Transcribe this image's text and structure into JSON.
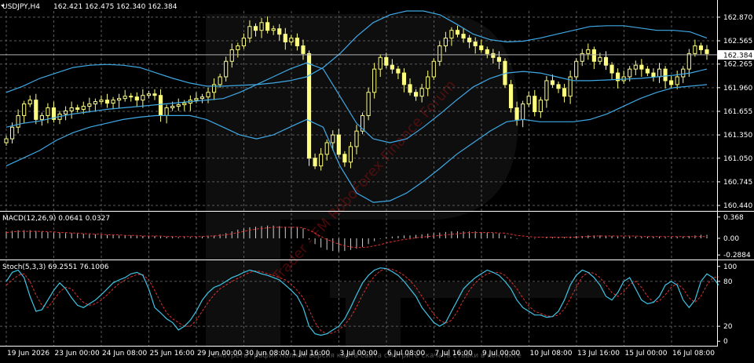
{
  "chart_data": [
    {
      "type": "candlestick",
      "panel": "price",
      "title": "USDJPY,H4",
      "ohlc_header": "162.421 162.475 162.340 162.384",
      "current_price": 162.384,
      "current_price_label": "162.384",
      "y_ticks": [
        {
          "v": 162.87,
          "label": "162.870"
        },
        {
          "v": 162.565,
          "label": "162.565"
        },
        {
          "v": 162.265,
          "label": "162.265"
        },
        {
          "v": 161.96,
          "label": "161.960"
        },
        {
          "v": 161.655,
          "label": "161.655"
        },
        {
          "v": 161.35,
          "label": "161.350"
        },
        {
          "v": 161.05,
          "label": "161.050"
        },
        {
          "v": 160.745,
          "label": "160.745"
        },
        {
          "v": 160.44,
          "label": "160.440"
        }
      ],
      "ylim": [
        160.4,
        162.95
      ],
      "x_labels": [
        "19 Jun 2026",
        "23 Jun 00:00",
        "24 Jun 08:00",
        "25 Jun 16:00",
        "29 Jun 00:00",
        "30 Jun 08:00",
        "1 Jul 16:00",
        "3 Jul 00:00",
        "6 Jul 08:00",
        "7 Jul 16:00",
        "9 Jul 00:00",
        "10 Jul 08:00",
        "13 Jul 16:00",
        "15 Jul 00:00",
        "16 Jul 08:00"
      ],
      "grid": true,
      "candle_color": "#ffff80",
      "band_color": "#3fa9e6",
      "closes": [
        161.3,
        161.45,
        161.6,
        161.75,
        161.8,
        161.55,
        161.6,
        161.7,
        161.55,
        161.62,
        161.66,
        161.7,
        161.68,
        161.72,
        161.75,
        161.78,
        161.8,
        161.76,
        161.8,
        161.82,
        161.85,
        161.84,
        161.8,
        161.86,
        161.88,
        161.86,
        161.6,
        161.7,
        161.72,
        161.74,
        161.76,
        161.8,
        161.82,
        161.84,
        161.9,
        162.0,
        162.1,
        162.3,
        162.45,
        162.5,
        162.6,
        162.75,
        162.7,
        162.8,
        162.7,
        162.72,
        162.65,
        162.55,
        162.6,
        162.5,
        162.4,
        161.05,
        160.95,
        161.1,
        161.25,
        161.35,
        161.1,
        161.0,
        161.2,
        161.4,
        161.6,
        161.9,
        162.2,
        162.35,
        162.25,
        162.2,
        162.15,
        162.0,
        161.9,
        161.85,
        161.95,
        162.1,
        162.3,
        162.5,
        162.6,
        162.7,
        162.65,
        162.6,
        162.55,
        162.5,
        162.45,
        162.4,
        162.35,
        162.3,
        162.0,
        161.7,
        161.55,
        161.75,
        161.85,
        161.65,
        161.8,
        162.05,
        162.0,
        161.95,
        161.85,
        162.1,
        162.3,
        162.4,
        162.45,
        162.3,
        162.35,
        162.25,
        162.15,
        162.05,
        162.1,
        162.2,
        162.25,
        162.2,
        162.15,
        162.1,
        162.2,
        162.05,
        162.0,
        162.1,
        162.2,
        162.4,
        162.5,
        162.45,
        162.4
      ],
      "bands": {
        "upper": [
          161.9,
          161.98,
          162.08,
          162.15,
          162.22,
          162.25,
          162.26,
          162.25,
          162.22,
          162.15,
          162.08,
          162.02,
          161.98,
          161.98,
          161.99,
          162.0,
          162.02,
          162.05,
          162.1,
          162.22,
          162.4,
          162.62,
          162.8,
          162.9,
          162.95,
          162.95,
          162.9,
          162.78,
          162.65,
          162.58,
          162.55,
          162.56,
          162.6,
          162.65,
          162.7,
          162.75,
          162.76,
          162.76,
          162.73,
          162.7,
          162.7,
          162.68,
          162.6
        ],
        "middle": [
          161.45,
          161.5,
          161.53,
          161.58,
          161.62,
          161.65,
          161.68,
          161.7,
          161.72,
          161.74,
          161.76,
          161.78,
          161.8,
          161.82,
          161.9,
          162.0,
          162.1,
          162.2,
          162.28,
          162.2,
          161.85,
          161.5,
          161.3,
          161.25,
          161.3,
          161.45,
          161.62,
          161.8,
          161.97,
          162.08,
          162.15,
          162.17,
          162.15,
          162.1,
          162.05,
          162.05,
          162.06,
          162.07,
          162.08,
          162.1,
          162.12,
          162.15,
          162.2
        ],
        "lower": [
          160.95,
          161.05,
          161.15,
          161.28,
          161.38,
          161.45,
          161.5,
          161.55,
          161.58,
          161.6,
          161.6,
          161.6,
          161.55,
          161.45,
          161.35,
          161.3,
          161.35,
          161.45,
          161.55,
          161.45,
          160.95,
          160.6,
          160.48,
          160.5,
          160.6,
          160.75,
          160.92,
          161.1,
          161.25,
          161.4,
          161.52,
          161.55,
          161.52,
          161.52,
          161.52,
          161.55,
          161.62,
          161.72,
          161.82,
          161.9,
          161.96,
          161.98,
          162.0
        ]
      }
    },
    {
      "type": "histogram",
      "panel": "macd",
      "title": "MACD(12,26,9) 0.0641 0.0327",
      "y_ticks": [
        {
          "v": 0.368,
          "label": "0.368"
        },
        {
          "v": 0.0,
          "label": "0.00"
        },
        {
          "v": -0.2884,
          "label": "-0.2884"
        }
      ],
      "ylim": [
        -0.34,
        0.42
      ],
      "histogram_color": "#d0d0d0",
      "signal_color": "#e03030",
      "histogram": [
        0.12,
        0.13,
        0.14,
        0.14,
        0.14,
        0.13,
        0.12,
        0.11,
        0.1,
        0.1,
        0.09,
        0.09,
        0.08,
        0.08,
        0.07,
        0.07,
        0.06,
        0.06,
        0.06,
        0.05,
        0.05,
        0.05,
        0.04,
        0.04,
        0.04,
        0.04,
        0.03,
        0.03,
        0.03,
        0.02,
        0.02,
        0.02,
        0.03,
        0.03,
        0.04,
        0.05,
        0.07,
        0.09,
        0.12,
        0.15,
        0.17,
        0.19,
        0.2,
        0.21,
        0.22,
        0.22,
        0.21,
        0.2,
        0.2,
        0.19,
        0.17,
        -0.02,
        -0.1,
        -0.16,
        -0.2,
        -0.22,
        -0.23,
        -0.22,
        -0.2,
        -0.18,
        -0.15,
        -0.1,
        -0.05,
        -0.01,
        0.02,
        0.03,
        0.04,
        0.05,
        0.05,
        0.06,
        0.07,
        0.08,
        0.09,
        0.1,
        0.11,
        0.12,
        0.12,
        0.12,
        0.12,
        0.12,
        0.11,
        0.1,
        0.09,
        0.08,
        0.05,
        0.02,
        -0.01,
        0.0,
        0.01,
        -0.01,
        0.0,
        0.02,
        0.02,
        0.02,
        0.02,
        0.03,
        0.04,
        0.04,
        0.05,
        0.05,
        0.05,
        0.04,
        0.04,
        0.03,
        0.03,
        0.03,
        0.03,
        0.03,
        0.03,
        0.03,
        0.03,
        0.02,
        0.02,
        0.03,
        0.03,
        0.04,
        0.05,
        0.06,
        0.06
      ],
      "signal": [
        0.1,
        0.11,
        0.12,
        0.12,
        0.12,
        0.12,
        0.12,
        0.11,
        0.11,
        0.1,
        0.1,
        0.09,
        0.09,
        0.08,
        0.08,
        0.07,
        0.07,
        0.06,
        0.06,
        0.06,
        0.05,
        0.05,
        0.05,
        0.04,
        0.04,
        0.04,
        0.04,
        0.03,
        0.03,
        0.03,
        0.03,
        0.03,
        0.03,
        0.03,
        0.04,
        0.04,
        0.05,
        0.06,
        0.08,
        0.1,
        0.12,
        0.14,
        0.16,
        0.17,
        0.18,
        0.19,
        0.19,
        0.19,
        0.19,
        0.19,
        0.18,
        0.14,
        0.09,
        0.03,
        -0.02,
        -0.06,
        -0.1,
        -0.13,
        -0.15,
        -0.16,
        -0.16,
        -0.15,
        -0.13,
        -0.11,
        -0.08,
        -0.06,
        -0.04,
        -0.02,
        -0.01,
        0.01,
        0.02,
        0.03,
        0.04,
        0.05,
        0.06,
        0.07,
        0.08,
        0.09,
        0.1,
        0.1,
        0.1,
        0.1,
        0.1,
        0.09,
        0.09,
        0.07,
        0.05,
        0.04,
        0.03,
        0.02,
        0.02,
        0.02,
        0.02,
        0.02,
        0.02,
        0.02,
        0.02,
        0.03,
        0.03,
        0.04,
        0.04,
        0.04,
        0.04,
        0.04,
        0.04,
        0.04,
        0.04,
        0.03,
        0.03,
        0.03,
        0.03,
        0.03,
        0.03,
        0.03,
        0.03,
        0.03,
        0.03,
        0.03,
        0.03
      ]
    },
    {
      "type": "line",
      "panel": "stochastic",
      "title": "Stoch(5,3,3) 69.2551 76.1006",
      "y_ticks": [
        {
          "v": 100,
          "label": "100"
        },
        {
          "v": 80,
          "label": "80"
        },
        {
          "v": 20,
          "label": "20"
        },
        {
          "v": 0,
          "label": "0"
        }
      ],
      "ylim": [
        -5,
        105
      ],
      "k_color": "#3fc6e6",
      "d_color": "#e03030",
      "k": [
        80,
        92,
        95,
        85,
        60,
        40,
        42,
        55,
        68,
        78,
        70,
        58,
        48,
        45,
        50,
        55,
        62,
        70,
        78,
        82,
        85,
        90,
        92,
        88,
        70,
        45,
        38,
        30,
        25,
        15,
        20,
        28,
        40,
        55,
        65,
        72,
        75,
        80,
        85,
        88,
        92,
        95,
        93,
        90,
        88,
        85,
        82,
        75,
        68,
        60,
        45,
        20,
        10,
        8,
        10,
        15,
        20,
        30,
        45,
        62,
        78,
        88,
        95,
        98,
        97,
        93,
        88,
        80,
        70,
        60,
        45,
        35,
        25,
        20,
        25,
        40,
        55,
        70,
        78,
        85,
        90,
        95,
        92,
        88,
        80,
        70,
        55,
        45,
        40,
        35,
        35,
        32,
        33,
        40,
        55,
        75,
        88,
        95,
        92,
        85,
        75,
        60,
        55,
        65,
        80,
        85,
        70,
        55,
        50,
        52,
        60,
        75,
        80,
        75,
        55,
        45,
        55,
        80,
        90,
        85,
        75
      ],
      "d": [
        75,
        82,
        88,
        90,
        80,
        62,
        48,
        45,
        55,
        66,
        72,
        70,
        60,
        52,
        48,
        50,
        55,
        62,
        70,
        77,
        82,
        86,
        89,
        89,
        82,
        68,
        52,
        38,
        30,
        25,
        20,
        20,
        28,
        40,
        52,
        62,
        70,
        75,
        80,
        84,
        88,
        92,
        94,
        93,
        90,
        88,
        85,
        82,
        76,
        68,
        58,
        42,
        25,
        14,
        10,
        11,
        15,
        22,
        32,
        46,
        62,
        76,
        87,
        94,
        97,
        96,
        93,
        88,
        81,
        72,
        60,
        48,
        36,
        28,
        24,
        28,
        40,
        55,
        68,
        78,
        85,
        90,
        92,
        92,
        88,
        80,
        70,
        58,
        47,
        40,
        37,
        34,
        33,
        35,
        43,
        57,
        72,
        86,
        92,
        91,
        85,
        75,
        65,
        60,
        66,
        76,
        80,
        72,
        60,
        52,
        54,
        62,
        72,
        77,
        70,
        58,
        52,
        60,
        75,
        85,
        86
      ]
    }
  ],
  "watermark": {
    "diagonal_text": "Trader - FM RoboForex Finance Forum",
    "bottom_text": "Смотреть график полная версия карта сайта смотрите скачать ставки в контакте"
  }
}
